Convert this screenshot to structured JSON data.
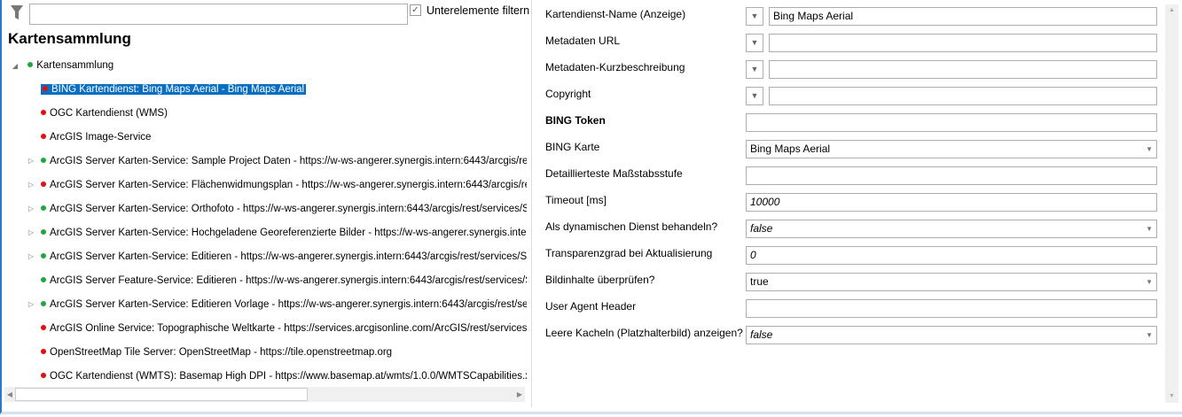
{
  "filter": {
    "search_value": "",
    "subfilter_label": "Unterelemente filtern",
    "subfilter_checked": true
  },
  "tree": {
    "title": "Kartensammlung",
    "root": {
      "label": "Kartensammlung",
      "status": "green"
    },
    "items": [
      {
        "label": "BING Kartendienst: Bing Maps Aerial - Bing Maps Aerial",
        "status": "red",
        "expandable": false,
        "selected": true
      },
      {
        "label": "OGC Kartendienst (WMS)",
        "status": "red",
        "expandable": false
      },
      {
        "label": "ArcGIS Image-Service",
        "status": "red",
        "expandable": false
      },
      {
        "label": "ArcGIS Server Karten-Service: Sample Project Daten - https://w-ws-angerer.synergis.intern:6443/arcgis/res",
        "status": "green",
        "expandable": true
      },
      {
        "label": "ArcGIS Server Karten-Service: Flächenwidmungsplan - https://w-ws-angerer.synergis.intern:6443/arcgis/re",
        "status": "red",
        "expandable": true
      },
      {
        "label": "ArcGIS Server Karten-Service: Orthofoto - https://w-ws-angerer.synergis.intern:6443/arcgis/rest/services/S",
        "status": "green",
        "expandable": true
      },
      {
        "label": "ArcGIS Server Karten-Service: Hochgeladene Georeferenzierte Bilder - https://w-ws-angerer.synergis.inter",
        "status": "green",
        "expandable": true
      },
      {
        "label": "ArcGIS Server Karten-Service: Editieren - https://w-ws-angerer.synergis.intern:6443/arcgis/rest/services/Sa",
        "status": "green",
        "expandable": true
      },
      {
        "label": "ArcGIS Server Feature-Service: Editieren - https://w-ws-angerer.synergis.intern:6443/arcgis/rest/services/S",
        "status": "green",
        "expandable": false
      },
      {
        "label": "ArcGIS Server Karten-Service: Editieren Vorlage - https://w-ws-angerer.synergis.intern:6443/arcgis/rest/se",
        "status": "green",
        "expandable": true
      },
      {
        "label": "ArcGIS Online Service: Topographische Weltkarte - https://services.arcgisonline.com/ArcGIS/rest/services/",
        "status": "red",
        "expandable": false
      },
      {
        "label": "OpenStreetMap Tile Server: OpenStreetMap - https://tile.openstreetmap.org",
        "status": "red",
        "expandable": false
      },
      {
        "label": "OGC Kartendienst (WMTS): Basemap High DPI - https://www.basemap.at/wmts/1.0.0/WMTSCapabilities.x",
        "status": "red",
        "expandable": false
      }
    ]
  },
  "properties": [
    {
      "label": "Kartendienst-Name (Anzeige)",
      "value": "Bing Maps Aerial",
      "type": "text-dd"
    },
    {
      "label": "Metadaten URL",
      "value": "",
      "type": "text-dd"
    },
    {
      "label": "Metadaten-Kurzbeschreibung",
      "value": "",
      "type": "text-dd"
    },
    {
      "label": "Copyright",
      "value": "",
      "type": "text-dd"
    },
    {
      "label": "BING Token",
      "value": "",
      "type": "text",
      "bold": true
    },
    {
      "label": "BING Karte",
      "value": "Bing Maps Aerial",
      "type": "select"
    },
    {
      "label": "Detaillierteste Maßstabsstufe",
      "value": "",
      "type": "text"
    },
    {
      "label": "Timeout [ms]",
      "value": "10000",
      "type": "text",
      "italic": true
    },
    {
      "label": "Als dynamischen Dienst behandeln?",
      "value": "false",
      "type": "select",
      "italic": true
    },
    {
      "label": "Transparenzgrad bei Aktualisierung",
      "value": "0",
      "type": "text",
      "italic": true
    },
    {
      "label": "Bildinhalte überprüfen?",
      "value": "true",
      "type": "select"
    },
    {
      "label": "User Agent Header",
      "value": "",
      "type": "text"
    },
    {
      "label": "Leere Kacheln (Platzhalterbild) anzeigen?",
      "value": "false",
      "type": "select",
      "italic": true
    }
  ],
  "colors": {
    "green": "#1fa83a",
    "red": "#e01010",
    "selection": "#0a6fc2"
  }
}
